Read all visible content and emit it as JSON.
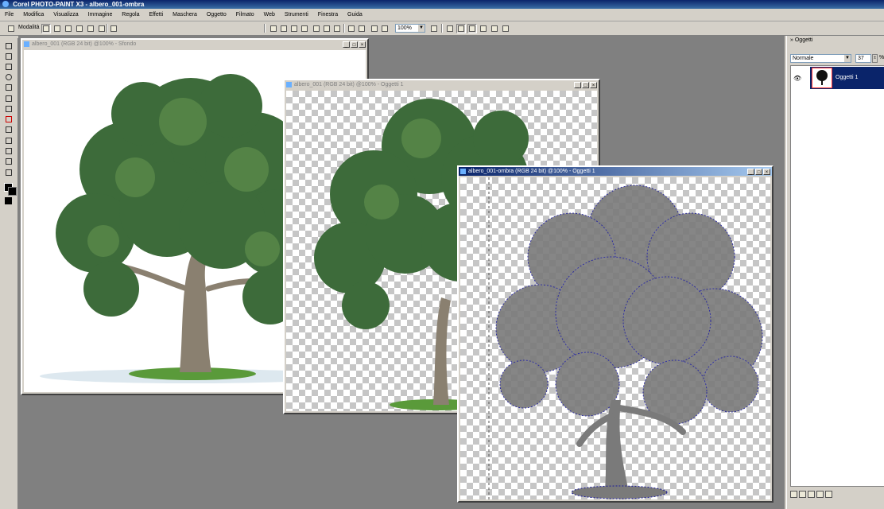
{
  "app": {
    "title": "Corel PHOTO-PAINT X3 - albero_001-ombra"
  },
  "menu": [
    "File",
    "Modifica",
    "Visualizza",
    "Immagine",
    "Regola",
    "Effetti",
    "Maschera",
    "Oggetto",
    "Filmato",
    "Web",
    "Strumenti",
    "Finestra",
    "Guida"
  ],
  "property_bar": {
    "mode_label": "Modalità"
  },
  "toolbar": {
    "zoom_value": "100%",
    "zoom_arrow": "▼"
  },
  "windows": [
    {
      "title": "albero_001 (RGB 24 bit) @100% - Sfondo",
      "state": "inactive"
    },
    {
      "title": "albero_001 (RGB 24 bit) @100% - Oggetti 1",
      "state": "inactive"
    },
    {
      "title": "albero_001-ombra (RGB 24 bit) @100% - Oggetti 1",
      "state": "active"
    }
  ],
  "window_buttons": {
    "minimize": "_",
    "maximize": "□",
    "close": "×"
  },
  "objects_panel": {
    "title": "Oggetti",
    "header_mark": "»",
    "blend_mode": "Normale",
    "dropdown_arrow": "▼",
    "opacity": "37",
    "opacity_unit": "%",
    "spin": "±",
    "close": "×",
    "layers": [
      {
        "name": "Oggetti 1",
        "visible_icon": "👁",
        "selected": true
      }
    ]
  },
  "colors": {
    "title_active": "#0a246a",
    "workspace": "#808080",
    "foliage": "#3d6b3a",
    "shadow": "#7a7a7a",
    "mask_outline": "#1c1c9a"
  },
  "icons": [
    "pointer-icon",
    "move-icon",
    "crop-icon",
    "zoom-icon",
    "eyedropper-icon",
    "paint-icon",
    "clone-icon",
    "shape-icon",
    "fill-icon",
    "eraser-icon",
    "text-icon",
    "effect-icon",
    "new-icon",
    "open-icon",
    "save-icon",
    "cut-icon",
    "copy-icon",
    "paste-icon",
    "undo-icon",
    "redo-icon",
    "import-icon",
    "export-icon",
    "mask-icon",
    "object-icon",
    "eye-icon"
  ]
}
